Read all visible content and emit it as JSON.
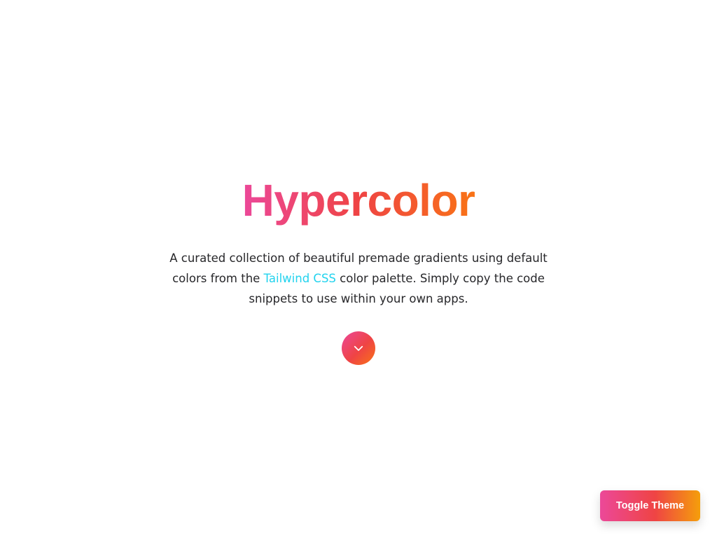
{
  "hero": {
    "title": "Hypercolor",
    "description_before_link": "A curated collection of beautiful premade gradients using default colors from the ",
    "link_text": "Tailwind CSS",
    "description_after_link": " color palette. Simply copy the code snippets to use within your own apps.",
    "scroll_icon": "chevron-down-icon"
  },
  "toggle_theme": {
    "label": "Toggle Theme"
  },
  "colors": {
    "gradient_start": "#ec4899",
    "gradient_mid": "#ef4444",
    "gradient_end": "#f97316",
    "link": "#22d3ee",
    "body_text": "#27272a",
    "background": "#ffffff"
  }
}
